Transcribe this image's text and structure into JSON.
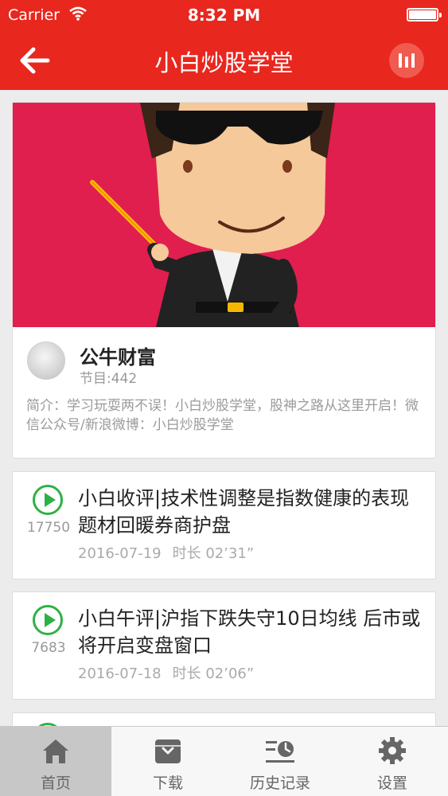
{
  "status_bar": {
    "carrier": "Carrier",
    "time": "8:32 PM"
  },
  "nav": {
    "title": "小白炒股学堂",
    "back_icon": "back-arrow-icon",
    "right_icon": "bars-icon"
  },
  "channel": {
    "name": "公牛财富",
    "program_count": "节目:442",
    "intro": "简介：学习玩耍两不误！小白炒股学堂，股神之路从这里开启！微信公众号/新浪微博：小白炒股学堂"
  },
  "episodes": [
    {
      "title": "小白收评|技术性调整是指数健康的表现 题材回暖券商护盘",
      "plays": "17750",
      "date": "2016-07-19",
      "duration": "时长 02’31”"
    },
    {
      "title": "小白午评|沪指下跌失守10日均线 后市或将开启变盘窗口",
      "plays": "7683",
      "date": "2016-07-18",
      "duration": "时长 02’06”"
    }
  ],
  "tabs": [
    {
      "label": "首页",
      "icon": "home-icon",
      "active": true
    },
    {
      "label": "下载",
      "icon": "download-icon"
    },
    {
      "label": "历史记录",
      "icon": "history-icon"
    },
    {
      "label": "设置",
      "icon": "gear-icon"
    }
  ],
  "colors": {
    "brand_red": "#e8271e",
    "banner_red": "#e01f4f",
    "play_green": "#2db146"
  }
}
